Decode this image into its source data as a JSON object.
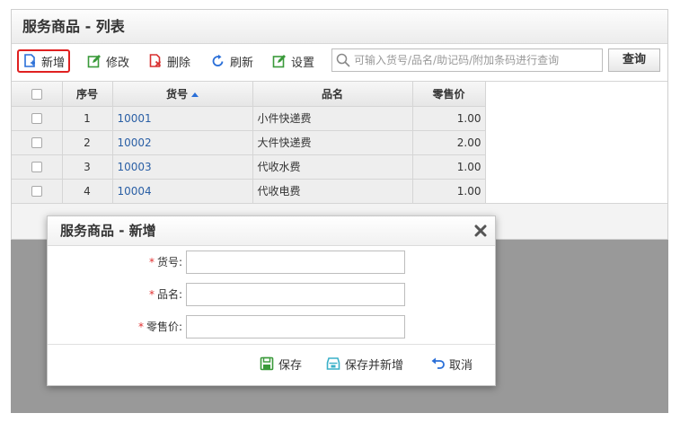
{
  "list": {
    "title": "服务商品 - 列表"
  },
  "toolbar": {
    "add_label": "新增",
    "edit_label": "修改",
    "delete_label": "删除",
    "refresh_label": "刷新",
    "settings_label": "设置",
    "search_placeholder": "可输入货号/品名/助记码/附加条码进行查询",
    "search_value": "",
    "query_label": "查询"
  },
  "grid": {
    "columns": [
      "序号",
      "货号",
      "品名",
      "零售价"
    ],
    "sort_column": "货号",
    "sort_direction": "ascending",
    "rows": [
      {
        "no": "1",
        "code": "10001",
        "name": "小件快递费",
        "price": "1.00"
      },
      {
        "no": "2",
        "code": "10002",
        "name": "大件快递费",
        "price": "2.00"
      },
      {
        "no": "3",
        "code": "10003",
        "name": "代收水费",
        "price": "1.00"
      },
      {
        "no": "4",
        "code": "10004",
        "name": "代收电费",
        "price": "1.00"
      }
    ]
  },
  "dialog": {
    "title": "服务商品 - 新增",
    "required_mark": "*",
    "fields": [
      {
        "label": "货号:",
        "value": ""
      },
      {
        "label": "品名:",
        "value": ""
      },
      {
        "label": "零售价:",
        "value": ""
      }
    ],
    "save_label": "保存",
    "save_new_label": "保存并新增",
    "cancel_label": "取消"
  },
  "colors": {
    "accent_blue": "#2a6fd8",
    "link_blue": "#2a5fa5",
    "active_border": "#e02020",
    "required_red": "#e03030",
    "icon_green": "#3a9a3a",
    "icon_red": "#d83030",
    "overlay_gray": "#999999"
  },
  "icons": {
    "add": "file-plus-icon",
    "edit": "edit-icon",
    "delete": "file-delete-icon",
    "refresh": "refresh-icon",
    "settings": "settings-icon",
    "search": "search-icon",
    "close": "close-icon",
    "save": "save-icon",
    "save_new": "save-new-icon",
    "cancel": "undo-icon"
  }
}
